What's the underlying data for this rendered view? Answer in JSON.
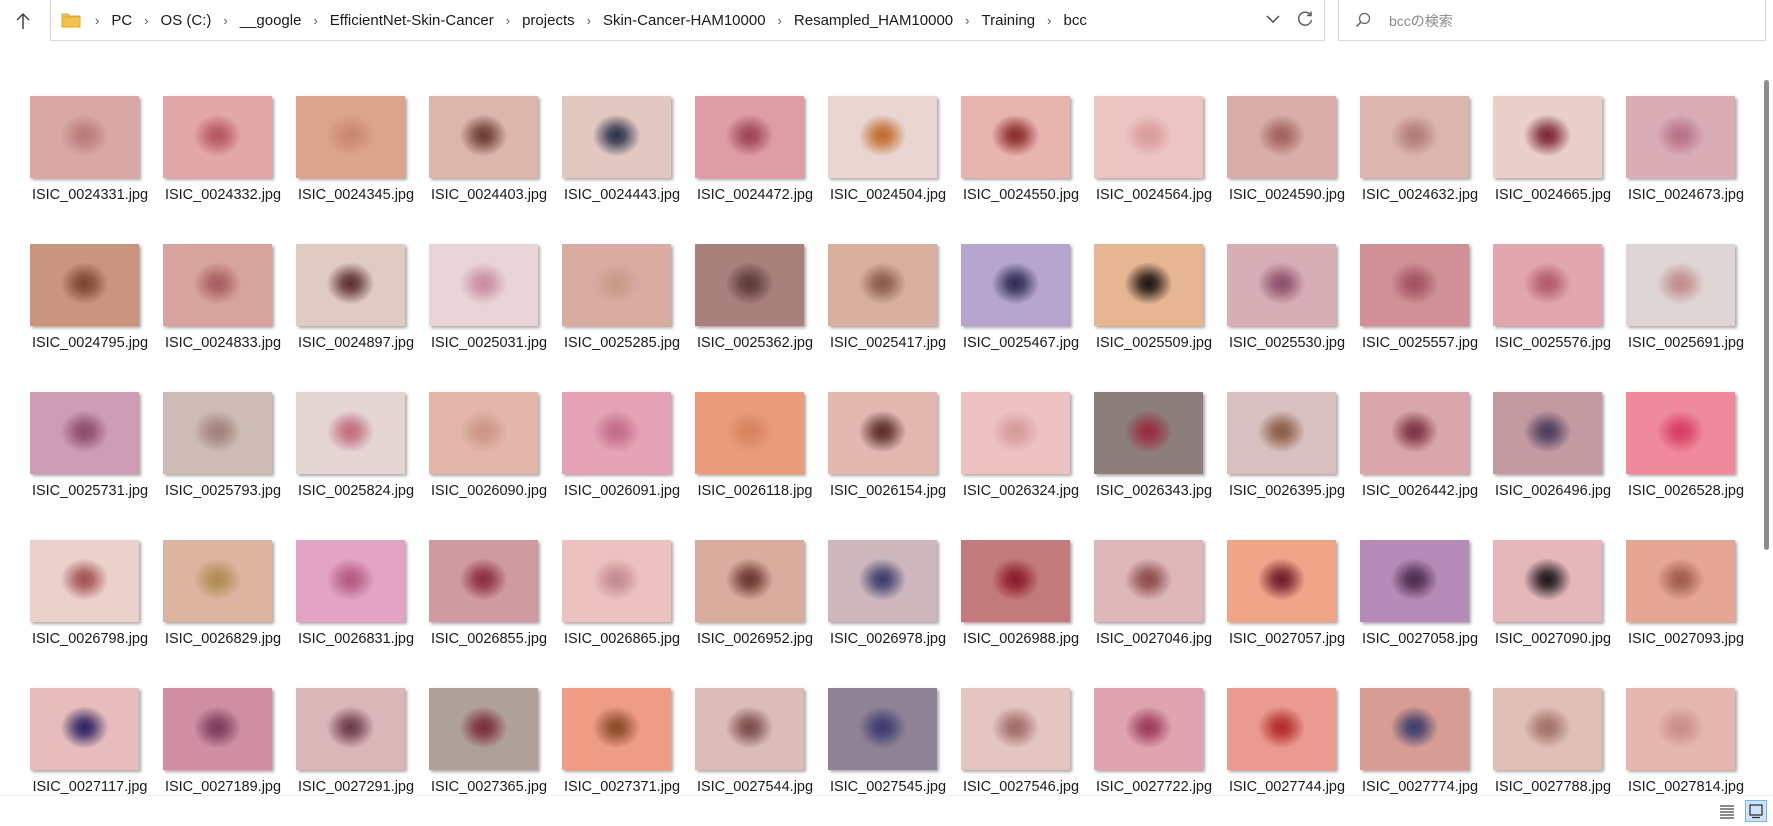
{
  "breadcrumb": [
    "PC",
    "OS (C:)",
    "__google",
    "EfficientNet-Skin-Cancer",
    "projects",
    "Skin-Cancer-HAM10000",
    "Resampled_HAM10000",
    "Training",
    "bcc"
  ],
  "search": {
    "placeholder": "bccの検索"
  },
  "icons": {
    "up": "arrow-up-icon",
    "folder": "folder-icon",
    "dropdown": "chevron-down-icon",
    "refresh": "refresh-icon",
    "search": "search-icon",
    "details_view": "details-view-icon",
    "thumbnail_view": "large-icons-view-icon"
  },
  "colors": {
    "folder": "#f2c14e",
    "selected_view": "#cfe4f8"
  },
  "files": [
    {
      "name": "ISIC_0024331.jpg",
      "skin": "#d9a8a4",
      "spot": "#b97a78"
    },
    {
      "name": "ISIC_0024332.jpg",
      "skin": "#e2a7a8",
      "spot": "#b5545e"
    },
    {
      "name": "ISIC_0024345.jpg",
      "skin": "#dca48c",
      "spot": "#c88772"
    },
    {
      "name": "ISIC_0024403.jpg",
      "skin": "#dcb6ad",
      "spot": "#6b3a34"
    },
    {
      "name": "ISIC_0024443.jpg",
      "skin": "#e3c8c2",
      "spot": "#27304a"
    },
    {
      "name": "ISIC_0024472.jpg",
      "skin": "#de9ca4",
      "spot": "#9a4556"
    },
    {
      "name": "ISIC_0024504.jpg",
      "skin": "#e9d6d3",
      "spot": "#c06a2a"
    },
    {
      "name": "ISIC_0024550.jpg",
      "skin": "#e8b4b0",
      "spot": "#8a2a2a"
    },
    {
      "name": "ISIC_0024564.jpg",
      "skin": "#ecc5c3",
      "spot": "#d99a9a"
    },
    {
      "name": "ISIC_0024590.jpg",
      "skin": "#d9aeaa",
      "spot": "#a0605a"
    },
    {
      "name": "ISIC_0024632.jpg",
      "skin": "#dcb5b0",
      "spot": "#b07a74"
    },
    {
      "name": "ISIC_0024665.jpg",
      "skin": "#ead0c8",
      "spot": "#7a2530"
    },
    {
      "name": "ISIC_0024673.jpg",
      "skin": "#d9adb6",
      "spot": "#b76f87"
    },
    {
      "name": "ISIC_0024795.jpg",
      "skin": "#c9957e",
      "spot": "#7a4630"
    },
    {
      "name": "ISIC_0024833.jpg",
      "skin": "#d7a39e",
      "spot": "#a85c60"
    },
    {
      "name": "ISIC_0024897.jpg",
      "skin": "#e0cbc3",
      "spot": "#5a2e2a"
    },
    {
      "name": "ISIC_0025031.jpg",
      "skin": "#e9d4d8",
      "spot": "#c88ca0"
    },
    {
      "name": "ISIC_0025285.jpg",
      "skin": "#d9aca2",
      "spot": "#c89a86"
    },
    {
      "name": "ISIC_0025362.jpg",
      "skin": "#a8807c",
      "spot": "#5a3a34"
    },
    {
      "name": "ISIC_0025417.jpg",
      "skin": "#d9b0a0",
      "spot": "#8a5a48"
    },
    {
      "name": "ISIC_0025467.jpg",
      "skin": "#b6a6cf",
      "spot": "#2d2a52"
    },
    {
      "name": "ISIC_0025509.jpg",
      "skin": "#e6b592",
      "spot": "#1a1210"
    },
    {
      "name": "ISIC_0025530.jpg",
      "skin": "#d7adb6",
      "spot": "#8c4f6a"
    },
    {
      "name": "ISIC_0025557.jpg",
      "skin": "#cf9096",
      "spot": "#a05060"
    },
    {
      "name": "ISIC_0025576.jpg",
      "skin": "#e2a7ae",
      "spot": "#b05a6a"
    },
    {
      "name": "ISIC_0025691.jpg",
      "skin": "#ded6d4",
      "spot": "#c08a8a"
    },
    {
      "name": "ISIC_0025731.jpg",
      "skin": "#cd9cb5",
      "spot": "#8a4a68"
    },
    {
      "name": "ISIC_0025793.jpg",
      "skin": "#cdbcb6",
      "spot": "#a08078"
    },
    {
      "name": "ISIC_0025824.jpg",
      "skin": "#e4d6d4",
      "spot": "#c26a7a"
    },
    {
      "name": "ISIC_0026090.jpg",
      "skin": "#e3b6aa",
      "spot": "#cc9484"
    },
    {
      "name": "ISIC_0026091.jpg",
      "skin": "#e4a3b6",
      "spot": "#c26a88"
    },
    {
      "name": "ISIC_0026118.jpg",
      "skin": "#e89c7c",
      "spot": "#d7835f"
    },
    {
      "name": "ISIC_0026154.jpg",
      "skin": "#e2b8b0",
      "spot": "#5a2a28"
    },
    {
      "name": "ISIC_0026324.jpg",
      "skin": "#ecc2c2",
      "spot": "#d69a9a"
    },
    {
      "name": "ISIC_0026343.jpg",
      "skin": "#8c7e7a",
      "spot": "#9a2a40"
    },
    {
      "name": "ISIC_0026395.jpg",
      "skin": "#d8c0c0",
      "spot": "#8a5a40"
    },
    {
      "name": "ISIC_0026442.jpg",
      "skin": "#d9a6ab",
      "spot": "#7a3040"
    },
    {
      "name": "ISIC_0026496.jpg",
      "skin": "#c49aa2",
      "spot": "#4a3a5a"
    },
    {
      "name": "ISIC_0026528.jpg",
      "skin": "#ef8a9c",
      "spot": "#d63a64"
    },
    {
      "name": "ISIC_0026798.jpg",
      "skin": "#ecd0cc",
      "spot": "#a05050"
    },
    {
      "name": "ISIC_0026829.jpg",
      "skin": "#dcb5a0",
      "spot": "#b08a50"
    },
    {
      "name": "ISIC_0026831.jpg",
      "skin": "#e2a3c4",
      "spot": "#b05a80"
    },
    {
      "name": "ISIC_0026855.jpg",
      "skin": "#cf9aa0",
      "spot": "#8a2a40"
    },
    {
      "name": "ISIC_0026865.jpg",
      "skin": "#ecc2c0",
      "spot": "#c28a90"
    },
    {
      "name": "ISIC_0026952.jpg",
      "skin": "#d9ad9e",
      "spot": "#6a3430"
    },
    {
      "name": "ISIC_0026978.jpg",
      "skin": "#cdb6bc",
      "spot": "#3a3a6a"
    },
    {
      "name": "ISIC_0026988.jpg",
      "skin": "#c27a7c",
      "spot": "#8a1a2a"
    },
    {
      "name": "ISIC_0027046.jpg",
      "skin": "#deb7bb",
      "spot": "#8a4a48"
    },
    {
      "name": "ISIC_0027057.jpg",
      "skin": "#f0a488",
      "spot": "#6a1a2a"
    },
    {
      "name": "ISIC_0027058.jpg",
      "skin": "#b78bb8",
      "spot": "#4a2a4a"
    },
    {
      "name": "ISIC_0027090.jpg",
      "skin": "#e4b7bb",
      "spot": "#1a1418"
    },
    {
      "name": "ISIC_0027093.jpg",
      "skin": "#e5a694",
      "spot": "#a05a48"
    },
    {
      "name": "ISIC_0027117.jpg",
      "skin": "#e6bcbc",
      "spot": "#2a2060"
    },
    {
      "name": "ISIC_0027189.jpg",
      "skin": "#cf8ea2",
      "spot": "#7a3a5a"
    },
    {
      "name": "ISIC_0027291.jpg",
      "skin": "#d9b6b8",
      "spot": "#6a3a48"
    },
    {
      "name": "ISIC_0027365.jpg",
      "skin": "#b0a09a",
      "spot": "#7a2a3a"
    },
    {
      "name": "ISIC_0027371.jpg",
      "skin": "#ef9c86",
      "spot": "#8a4a28"
    },
    {
      "name": "ISIC_0027544.jpg",
      "skin": "#dcbcb6",
      "spot": "#7a4a48"
    },
    {
      "name": "ISIC_0027545.jpg",
      "skin": "#8e8296",
      "spot": "#3a3a70"
    },
    {
      "name": "ISIC_0027546.jpg",
      "skin": "#e4c6c0",
      "spot": "#a06a68"
    },
    {
      "name": "ISIC_0027722.jpg",
      "skin": "#e0a4b0",
      "spot": "#9a3a58"
    },
    {
      "name": "ISIC_0027744.jpg",
      "skin": "#ea9a90",
      "spot": "#b02a2a"
    },
    {
      "name": "ISIC_0027774.jpg",
      "skin": "#d79c94",
      "spot": "#3a3a6a"
    },
    {
      "name": "ISIC_0027788.jpg",
      "skin": "#e0c0b6",
      "spot": "#a07068"
    },
    {
      "name": "ISIC_0027814.jpg",
      "skin": "#e6b6b0",
      "spot": "#c88c8a"
    }
  ]
}
